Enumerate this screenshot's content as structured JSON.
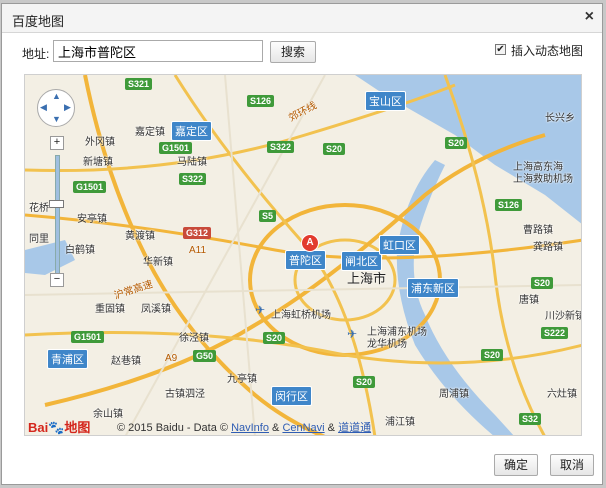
{
  "dialog": {
    "title": "百度地图",
    "close_icon": "close-icon"
  },
  "search": {
    "label": "地址:",
    "value": "上海市普陀区",
    "button": "搜索"
  },
  "dynamic_map": {
    "checked": true,
    "label": "插入动态地图"
  },
  "map": {
    "districts": [
      "宝山区",
      "嘉定区",
      "普陀区",
      "闸北区",
      "虹口区",
      "浦东新区",
      "青浦区",
      "闵行区"
    ],
    "city_label": "上海市",
    "marker": "A",
    "towns": [
      "长兴乡",
      "外冈镇",
      "嘉定镇",
      "新塘镇",
      "马陆镇",
      "安亭镇",
      "黄渡镇",
      "白鹤镇",
      "华新镇",
      "重固镇",
      "凤溪镇",
      "徐泾镇",
      "赵巷镇",
      "九亭镇",
      "古镇泗泾",
      "余山镇",
      "曹路镇",
      "龚路镇",
      "唐镇",
      "川沙新镇",
      "周浦镇",
      "六灶镇",
      "浦江镇",
      "上海高东海",
      "上海救助机场",
      "花桥",
      "同里"
    ],
    "airports": [
      "上海虹桥机场",
      "上海浦东机场",
      "龙华机场"
    ],
    "roads": [
      "郊环线",
      "沪常高速",
      "A11",
      "A9"
    ],
    "route_shields": [
      "S321",
      "S126",
      "S322",
      "S20",
      "S20",
      "G1501",
      "G1501",
      "S322",
      "S5",
      "G312",
      "G1501",
      "S20",
      "G50",
      "S20",
      "S20",
      "S20",
      "S222",
      "S32",
      "S126"
    ],
    "copyright": "© 2015 Baidu - Data ©",
    "providers": [
      "NavInfo",
      "CenNavi",
      "道道通"
    ],
    "logo_text": "Bai",
    "logo_text2": "地图"
  },
  "footer": {
    "ok": "确定",
    "cancel": "取消"
  },
  "colors": {
    "district_badge": "#3f86c9",
    "route_shield": "#3f9a3a",
    "marker": "#e23b2e",
    "water": "#a8c8e8",
    "land": "#f3efe4"
  }
}
